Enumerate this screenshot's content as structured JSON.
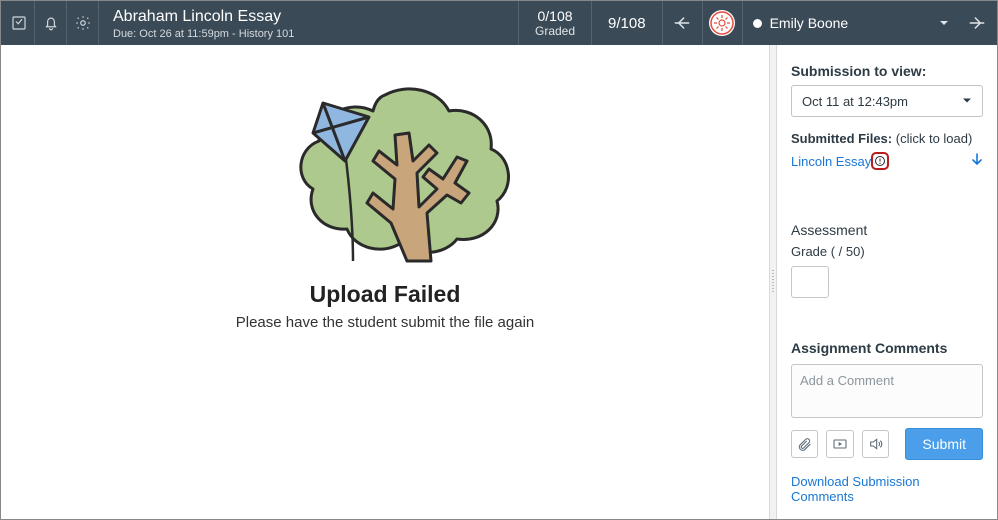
{
  "header": {
    "assignment_title": "Abraham Lincoln Essay",
    "due_line": "Due: Oct 26 at 11:59pm - History 101",
    "graded_count": "0/108",
    "graded_label": "Graded",
    "paging": "9/108",
    "student_name": "Emily Boone"
  },
  "main": {
    "title": "Upload Failed",
    "message": "Please have the student submit the file again"
  },
  "sidebar": {
    "submission_label": "Submission to view:",
    "submission_selected": "Oct 11 at 12:43pm",
    "submitted_files_label": "Submitted Files:",
    "submitted_files_hint": "(click to load)",
    "file_name": "Lincoln Essay",
    "assessment_heading": "Assessment",
    "grade_line": "Grade ( / 50)",
    "comments_heading": "Assignment Comments",
    "comment_placeholder": "Add a Comment",
    "submit_label": "Submit",
    "download_comments": "Download Submission Comments"
  }
}
